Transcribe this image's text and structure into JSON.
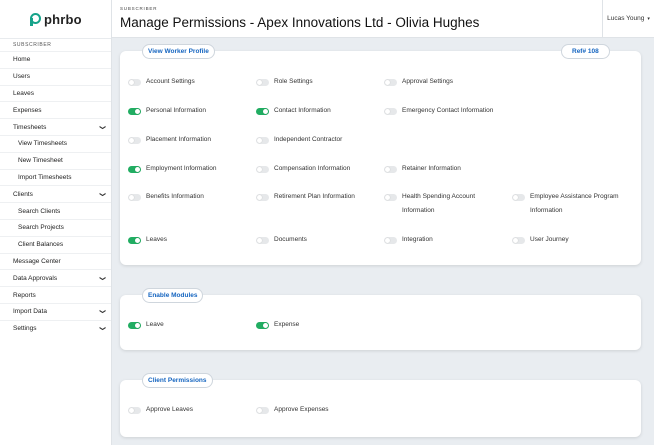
{
  "app": {
    "logo_text": "phrbo"
  },
  "sidebar": {
    "section_label": "SUBSCRIBER",
    "items": [
      {
        "label": "Home",
        "type": "item"
      },
      {
        "label": "Users",
        "type": "item"
      },
      {
        "label": "Leaves",
        "type": "item"
      },
      {
        "label": "Expenses",
        "type": "item"
      },
      {
        "label": "Timesheets",
        "type": "group",
        "chevron": "chevron-down-icon"
      },
      {
        "label": "View Timesheets",
        "type": "sub"
      },
      {
        "label": "New Timesheet",
        "type": "sub"
      },
      {
        "label": "Import Timesheets",
        "type": "sub"
      },
      {
        "label": "Clients",
        "type": "group",
        "chevron": "chevron-down-icon"
      },
      {
        "label": "Search Clients",
        "type": "sub"
      },
      {
        "label": "Search Projects",
        "type": "sub"
      },
      {
        "label": "Client Balances",
        "type": "sub"
      },
      {
        "label": "Message Center",
        "type": "item"
      },
      {
        "label": "Data Approvals",
        "type": "group",
        "chevron": "chevron-down-icon"
      },
      {
        "label": "Reports",
        "type": "item"
      },
      {
        "label": "Import Data",
        "type": "group",
        "chevron": "chevron-down-icon"
      },
      {
        "label": "Settings",
        "type": "group",
        "chevron": "chevron-down-icon"
      }
    ]
  },
  "header": {
    "label": "SUBSCRIBER",
    "title": "Manage Permissions - Apex Innovations Ltd - Olivia Hughes",
    "user_name": "Lucas Young"
  },
  "cards": {
    "profile": {
      "label": "View Worker Profile",
      "ref": "Ref# 108",
      "permissions": [
        {
          "label": "Account Settings",
          "on": false
        },
        {
          "label": "Role Settings",
          "on": false
        },
        {
          "label": "Approval Settings",
          "on": false
        },
        {
          "label": "Personal Information",
          "on": true
        },
        {
          "label": "Contact Information",
          "on": true
        },
        {
          "label": "Emergency Contact Information",
          "on": false
        },
        {
          "label": "Placement Information",
          "on": false
        },
        {
          "label": "Independent Contractor",
          "on": false
        },
        {
          "label": "Employment Information",
          "on": true
        },
        {
          "label": "Compensation Information",
          "on": false
        },
        {
          "label": "Retainer Information",
          "on": false
        },
        {
          "label": "Benefits Information",
          "on": false
        },
        {
          "label": "Retirement Plan Information",
          "on": false
        },
        {
          "label": "Health Spending Account Information",
          "on": false
        },
        {
          "label": "Employee Assistance Program Information",
          "on": false
        },
        {
          "label": "Leaves",
          "on": true
        },
        {
          "label": "Documents",
          "on": false
        },
        {
          "label": "Integration",
          "on": false
        },
        {
          "label": "User Journey",
          "on": false
        }
      ]
    },
    "modules": {
      "label": "Enable Modules",
      "permissions": [
        {
          "label": "Leave",
          "on": true
        },
        {
          "label": "Expense",
          "on": true
        }
      ]
    },
    "client": {
      "label": "Client Permissions",
      "permissions": [
        {
          "label": "Approve Leaves",
          "on": false
        },
        {
          "label": "Approve Expenses",
          "on": false
        }
      ]
    }
  },
  "colors": {
    "accent_green": "#21ad62",
    "link_blue": "#1565c0",
    "brand": "#16a38a"
  }
}
